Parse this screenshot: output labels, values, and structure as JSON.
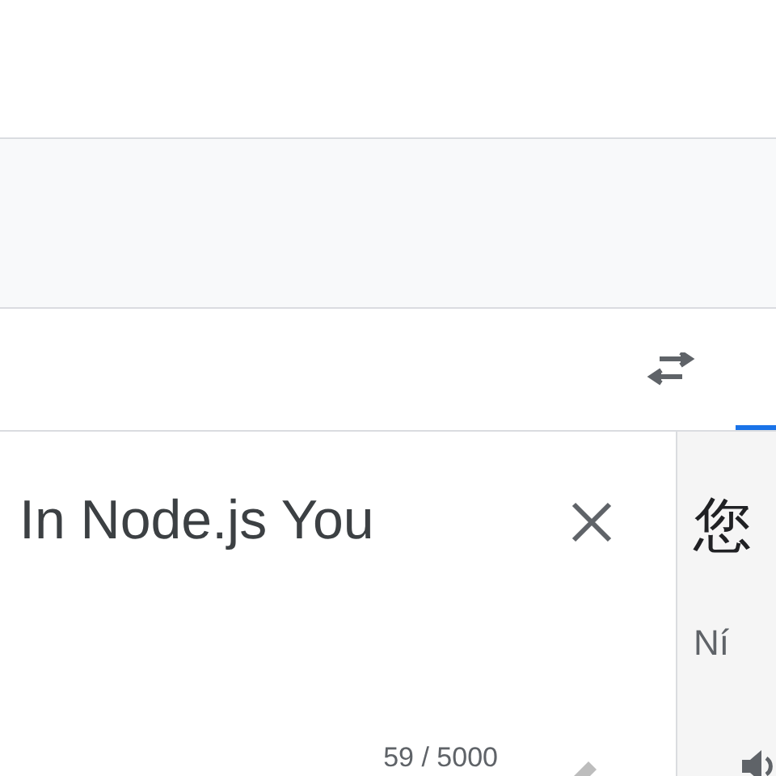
{
  "source": {
    "text": "In Node.js You",
    "char_count": "59 / 5000"
  },
  "translation": {
    "text": "您",
    "pinyin": "Ní"
  }
}
